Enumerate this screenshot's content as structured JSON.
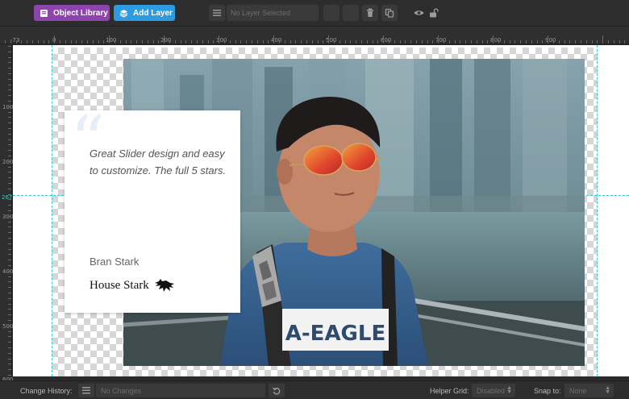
{
  "toolbar": {
    "object_library_label": "Object Library",
    "add_layer_label": "Add Layer",
    "layer_selected_label": "No Layer Selected"
  },
  "ruler": {
    "top_labels": [
      "-73",
      "0",
      "100",
      "200",
      "300",
      "400",
      "500",
      "600",
      "700",
      "800",
      "900"
    ],
    "left_labels": [
      "100",
      "200",
      "267",
      "300",
      "400",
      "500",
      "600"
    ]
  },
  "slide": {
    "quote": "Great Slider design and easy to customize. The full 5 stars.",
    "author": "Bran Stark",
    "house": "House Stark",
    "shirt_text": "A-EAGLE"
  },
  "bottom": {
    "change_history_label": "Change History:",
    "change_history_value": "No Changes",
    "helper_grid_label": "Helper Grid:",
    "helper_grid_value": "Disabled",
    "snap_to_label": "Snap to:",
    "snap_to_value": "None"
  },
  "colors": {
    "object_library": "#8e44ad",
    "add_layer": "#2e9be0",
    "guide": "#3ac6d0"
  }
}
